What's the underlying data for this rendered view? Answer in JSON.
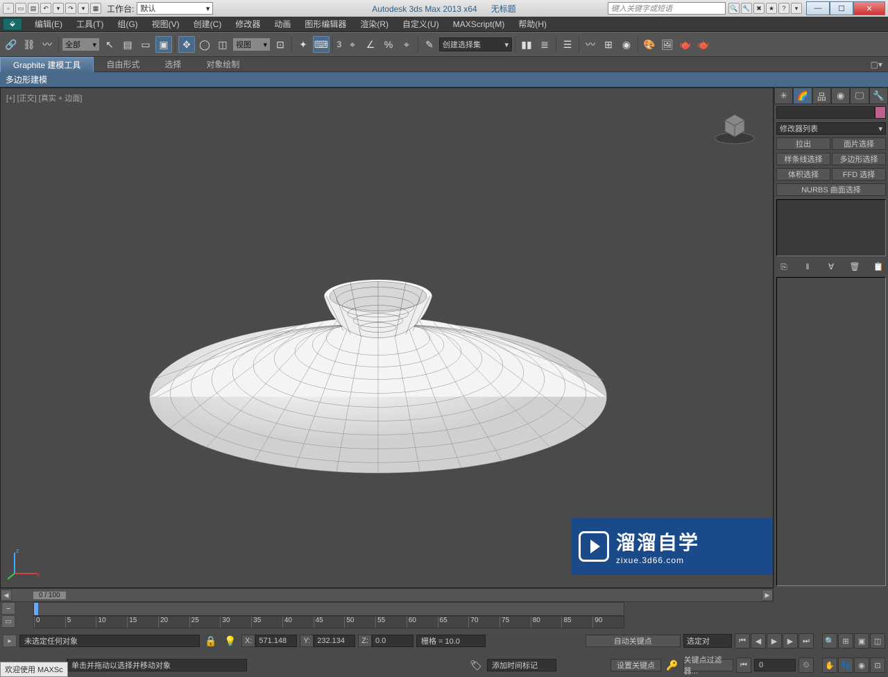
{
  "titlebar": {
    "workspace_label": "工作台:",
    "workspace_value": "默认",
    "app_title": "Autodesk 3ds Max  2013 x64",
    "doc_title": "无标题",
    "search_placeholder": "键入关键字或短语"
  },
  "menu": {
    "edit": "编辑(E)",
    "tools": "工具(T)",
    "group": "组(G)",
    "views": "视图(V)",
    "create": "创建(C)",
    "modifiers": "修改器",
    "animation": "动画",
    "graph": "图形编辑器",
    "rendering": "渲染(R)",
    "customize": "自定义(U)",
    "maxscript": "MAXScript(M)",
    "help": "帮助(H)"
  },
  "toolbar": {
    "filter_all": "全部",
    "refcoord": "视图",
    "selset_placeholder": "创建选择集",
    "snap_angle": "3"
  },
  "ribbon": {
    "tab_graphite": "Graphite 建模工具",
    "tab_freeform": "自由形式",
    "tab_select": "选择",
    "tab_objpaint": "对象绘制",
    "panel_polymodel": "多边形建模"
  },
  "viewport": {
    "label": "[+] [正交] [真实 + 边面]"
  },
  "watermark": {
    "big": "溜溜自学",
    "small": "zixue.3d66.com"
  },
  "timeline": {
    "frame_indicator": "0 / 100",
    "ticks": [
      "0",
      "5",
      "10",
      "15",
      "20",
      "25",
      "30",
      "35",
      "40",
      "45",
      "50",
      "55",
      "60",
      "65",
      "70",
      "75",
      "80",
      "85",
      "90"
    ]
  },
  "status": {
    "no_select": "未选定任何对象",
    "hint": "单击并拖动以选择并移动对象",
    "x": "571.148",
    "y": "232.134",
    "z": "0.0",
    "grid": "栅格 = 10.0",
    "add_time_tag": "添加时间标记",
    "autokey": "自动关键点",
    "setkey": "设置关键点",
    "sel_label": "选定对",
    "keyfilter": "关键点过滤器...",
    "mframe": "0",
    "welcome": "欢迎使用  MAXSc"
  },
  "cmdpanel": {
    "modlist": "修改器列表",
    "btn_extrude": "拉出",
    "btn_face": "面片选择",
    "btn_spline": "样条线选择",
    "btn_poly": "多边形选择",
    "btn_volume": "体积选择",
    "btn_ffd": "FFD 选择",
    "btn_nurbs": "NURBS 曲面选择"
  }
}
